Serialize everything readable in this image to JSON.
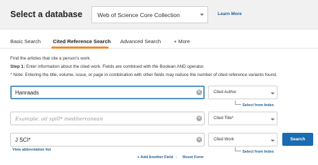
{
  "header": {
    "title": "Select a database",
    "database": "Web of Science Core Collection",
    "learn_more": "Learn More"
  },
  "tabs": [
    {
      "label": "Basic Search"
    },
    {
      "label": "Cited Reference Search",
      "active": true
    },
    {
      "label": "Advanced Search"
    },
    {
      "label": "+  More"
    }
  ],
  "instructions": {
    "line1": "Find the articles that cite a person's work.",
    "step_label": "Step 1:",
    "step_text": " Enter information about the cited work. Fields are combined with the Boolean AND operator.",
    "note": "* Note: Entering the title, volume, issue, or page in combination with other fields may reduce the number of cited reference variants found."
  },
  "fields": [
    {
      "value": "Hanraads",
      "placeholder": "",
      "select": "Cited Author",
      "index_link": "Select from Index"
    },
    {
      "value": "",
      "placeholder": "Example: oil spill* mediterranean",
      "select": "Cited Title*",
      "index_link": ""
    },
    {
      "value": "J SCI*",
      "placeholder": "",
      "select": "Cited Work",
      "index_link": "Select from Index",
      "abbrev_link": "View abbreviation list"
    }
  ],
  "actions": {
    "search": "Search",
    "add_field": "+ Add Another Field",
    "separator": "|",
    "reset": "Reset Form"
  },
  "colors": {
    "accent_tab": "#f08a24",
    "link": "#1f5e96",
    "search_button": "#1a6bb1",
    "focus_border": "#4d94c9"
  }
}
